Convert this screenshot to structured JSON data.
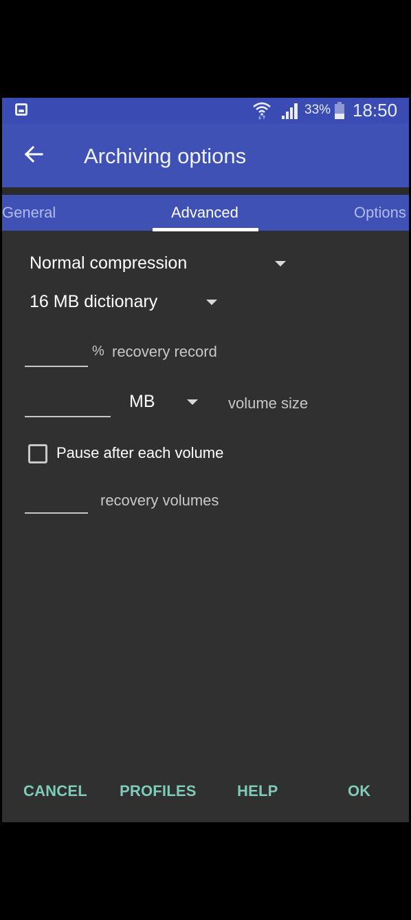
{
  "status_bar": {
    "notification_icon": "image-icon",
    "wifi_icon": "wifi-icon",
    "signal_icon": "cellular-signal-icon",
    "battery_percent": "33%",
    "battery_icon": "battery-icon",
    "time": "18:50"
  },
  "app_bar": {
    "back_icon": "arrow-left-icon",
    "title": "Archiving options"
  },
  "tabs": [
    {
      "label": "General",
      "selected": false
    },
    {
      "label": "Advanced",
      "selected": true
    },
    {
      "label": "Options",
      "selected": false
    }
  ],
  "advanced": {
    "compression": {
      "value": "Normal compression"
    },
    "dictionary": {
      "value": "16 MB dictionary"
    },
    "recovery_record": {
      "value": "",
      "unit": "%",
      "label": "recovery record"
    },
    "volume_size": {
      "value": "",
      "unit": "MB",
      "label": "volume size"
    },
    "pause_after_each_volume": {
      "label": "Pause after each volume",
      "checked": false
    },
    "recovery_volumes": {
      "value": "",
      "label": "recovery volumes"
    }
  },
  "actions": {
    "cancel": "CANCEL",
    "profiles": "PROFILES",
    "help": "HELP",
    "ok": "OK"
  },
  "colors": {
    "primary": "#3f51b5",
    "status_bar": "#3a4cb4",
    "background": "#303030",
    "accent": "#7fcbba"
  }
}
